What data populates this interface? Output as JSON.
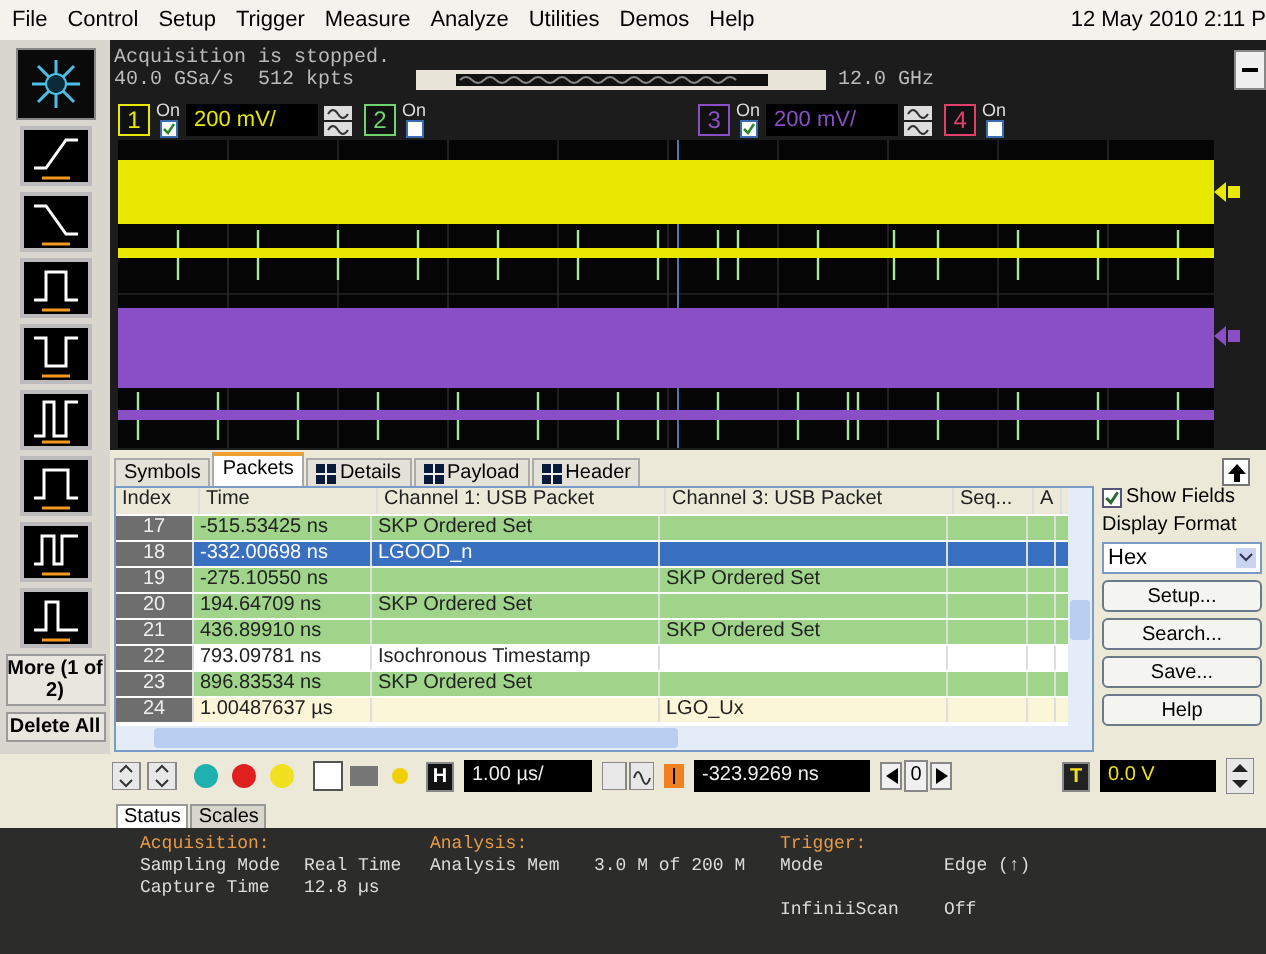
{
  "menu": {
    "items": [
      "File",
      "Control",
      "Setup",
      "Trigger",
      "Measure",
      "Analyze",
      "Utilities",
      "Demos",
      "Help"
    ],
    "datetime": "12 May 2010  2:11 P"
  },
  "acquisition": {
    "status": "Acquisition is stopped.",
    "sample_rate": "40.0 GSa/s",
    "points": "512 kpts",
    "bandwidth": "12.0 GHz"
  },
  "channels": [
    {
      "number": "1",
      "on_label": "On",
      "on": true,
      "scale": "200 mV/",
      "color": "#e8e800"
    },
    {
      "number": "2",
      "on_label": "On",
      "on": false,
      "color": "#6fd46f"
    },
    {
      "number": "3",
      "on_label": "On",
      "on": true,
      "scale": "200 mV/",
      "color": "#8a4fc4"
    },
    {
      "number": "4",
      "on_label": "On",
      "on": false,
      "color": "#e0406a"
    }
  ],
  "left_panel": {
    "more": "More (1 of 2)",
    "delete": "Delete All"
  },
  "tabs": [
    {
      "label": "Symbols",
      "selected": false,
      "icon": false
    },
    {
      "label": "Packets",
      "selected": true,
      "icon": false
    },
    {
      "label": "Details",
      "selected": false,
      "icon": true
    },
    {
      "label": "Payload",
      "selected": false,
      "icon": true
    },
    {
      "label": "Header",
      "selected": false,
      "icon": true
    }
  ],
  "table": {
    "columns": [
      "Index",
      "Time",
      "Channel 1: USB Packet",
      "Channel 3: USB Packet",
      "Seq...",
      "A"
    ],
    "rows": [
      {
        "index": "17",
        "time": "-515.53425 ns",
        "ch1": "SKP Ordered Set",
        "ch3": "",
        "selected": false,
        "color": "#9fd48a"
      },
      {
        "index": "18",
        "time": "-332.00698 ns",
        "ch1": "LGOOD_n",
        "ch3": "",
        "selected": true
      },
      {
        "index": "19",
        "time": "-275.10550 ns",
        "ch1": "",
        "ch3": "SKP Ordered Set",
        "selected": false,
        "color": "#9fd48a"
      },
      {
        "index": "20",
        "time": "194.64709 ns",
        "ch1": "SKP Ordered Set",
        "ch3": "",
        "selected": false,
        "color": "#9fd48a"
      },
      {
        "index": "21",
        "time": "436.89910 ns",
        "ch1": "",
        "ch3": "SKP Ordered Set",
        "selected": false,
        "color": "#9fd48a"
      },
      {
        "index": "22",
        "time": "793.09781 ns",
        "ch1": "Isochronous Timestamp",
        "ch3": "",
        "selected": false,
        "color": "#ffffff"
      },
      {
        "index": "23",
        "time": "896.83534 ns",
        "ch1": "SKP Ordered Set",
        "ch3": "",
        "selected": false,
        "color": "#9fd48a"
      },
      {
        "index": "24",
        "time": "1.00487637 µs",
        "ch1": "",
        "ch3": "LGO_Ux",
        "selected": false,
        "color": "#fbf6d8"
      }
    ]
  },
  "side": {
    "show_fields": {
      "label": "Show Fields",
      "checked": true
    },
    "display_format": "Display Format",
    "format_value": "Hex",
    "buttons": [
      "Setup...",
      "Search...",
      "Save...",
      "Help"
    ]
  },
  "toolbar": {
    "horizontal_label": "H",
    "trigger_label": "T",
    "timebase": "1.00 µs/",
    "delay": "-323.9269 ns",
    "counter": "0",
    "trigger_level": "0.0 V"
  },
  "status_tabs": [
    {
      "label": "Status",
      "selected": true
    },
    {
      "label": "Scales",
      "selected": false
    }
  ],
  "status": [
    {
      "title": "Acquisition:",
      "rows": [
        [
          "Sampling Mode",
          "Real Time"
        ],
        [
          "Capture Time",
          "12.8 µs"
        ]
      ]
    },
    {
      "title": "Analysis:",
      "rows": [
        [
          "Analysis Mem",
          "3.0 M of 200 M"
        ]
      ]
    },
    {
      "title": "Trigger:",
      "rows": [
        [
          "Mode",
          "Edge (↑)"
        ],
        [
          "InfiniiScan",
          "Off"
        ]
      ]
    }
  ]
}
